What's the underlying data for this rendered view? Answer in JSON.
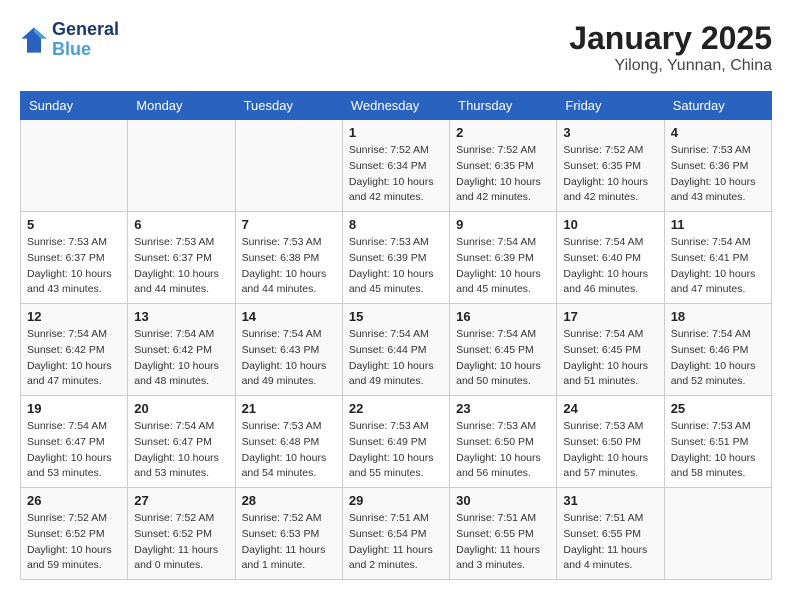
{
  "header": {
    "logo_line1": "General",
    "logo_line2": "Blue",
    "title": "January 2025",
    "subtitle": "Yilong, Yunnan, China"
  },
  "days_of_week": [
    "Sunday",
    "Monday",
    "Tuesday",
    "Wednesday",
    "Thursday",
    "Friday",
    "Saturday"
  ],
  "weeks": [
    [
      {
        "day": "",
        "info": ""
      },
      {
        "day": "",
        "info": ""
      },
      {
        "day": "",
        "info": ""
      },
      {
        "day": "1",
        "info": "Sunrise: 7:52 AM\nSunset: 6:34 PM\nDaylight: 10 hours\nand 42 minutes."
      },
      {
        "day": "2",
        "info": "Sunrise: 7:52 AM\nSunset: 6:35 PM\nDaylight: 10 hours\nand 42 minutes."
      },
      {
        "day": "3",
        "info": "Sunrise: 7:52 AM\nSunset: 6:35 PM\nDaylight: 10 hours\nand 42 minutes."
      },
      {
        "day": "4",
        "info": "Sunrise: 7:53 AM\nSunset: 6:36 PM\nDaylight: 10 hours\nand 43 minutes."
      }
    ],
    [
      {
        "day": "5",
        "info": "Sunrise: 7:53 AM\nSunset: 6:37 PM\nDaylight: 10 hours\nand 43 minutes."
      },
      {
        "day": "6",
        "info": "Sunrise: 7:53 AM\nSunset: 6:37 PM\nDaylight: 10 hours\nand 44 minutes."
      },
      {
        "day": "7",
        "info": "Sunrise: 7:53 AM\nSunset: 6:38 PM\nDaylight: 10 hours\nand 44 minutes."
      },
      {
        "day": "8",
        "info": "Sunrise: 7:53 AM\nSunset: 6:39 PM\nDaylight: 10 hours\nand 45 minutes."
      },
      {
        "day": "9",
        "info": "Sunrise: 7:54 AM\nSunset: 6:39 PM\nDaylight: 10 hours\nand 45 minutes."
      },
      {
        "day": "10",
        "info": "Sunrise: 7:54 AM\nSunset: 6:40 PM\nDaylight: 10 hours\nand 46 minutes."
      },
      {
        "day": "11",
        "info": "Sunrise: 7:54 AM\nSunset: 6:41 PM\nDaylight: 10 hours\nand 47 minutes."
      }
    ],
    [
      {
        "day": "12",
        "info": "Sunrise: 7:54 AM\nSunset: 6:42 PM\nDaylight: 10 hours\nand 47 minutes."
      },
      {
        "day": "13",
        "info": "Sunrise: 7:54 AM\nSunset: 6:42 PM\nDaylight: 10 hours\nand 48 minutes."
      },
      {
        "day": "14",
        "info": "Sunrise: 7:54 AM\nSunset: 6:43 PM\nDaylight: 10 hours\nand 49 minutes."
      },
      {
        "day": "15",
        "info": "Sunrise: 7:54 AM\nSunset: 6:44 PM\nDaylight: 10 hours\nand 49 minutes."
      },
      {
        "day": "16",
        "info": "Sunrise: 7:54 AM\nSunset: 6:45 PM\nDaylight: 10 hours\nand 50 minutes."
      },
      {
        "day": "17",
        "info": "Sunrise: 7:54 AM\nSunset: 6:45 PM\nDaylight: 10 hours\nand 51 minutes."
      },
      {
        "day": "18",
        "info": "Sunrise: 7:54 AM\nSunset: 6:46 PM\nDaylight: 10 hours\nand 52 minutes."
      }
    ],
    [
      {
        "day": "19",
        "info": "Sunrise: 7:54 AM\nSunset: 6:47 PM\nDaylight: 10 hours\nand 53 minutes."
      },
      {
        "day": "20",
        "info": "Sunrise: 7:54 AM\nSunset: 6:47 PM\nDaylight: 10 hours\nand 53 minutes."
      },
      {
        "day": "21",
        "info": "Sunrise: 7:53 AM\nSunset: 6:48 PM\nDaylight: 10 hours\nand 54 minutes."
      },
      {
        "day": "22",
        "info": "Sunrise: 7:53 AM\nSunset: 6:49 PM\nDaylight: 10 hours\nand 55 minutes."
      },
      {
        "day": "23",
        "info": "Sunrise: 7:53 AM\nSunset: 6:50 PM\nDaylight: 10 hours\nand 56 minutes."
      },
      {
        "day": "24",
        "info": "Sunrise: 7:53 AM\nSunset: 6:50 PM\nDaylight: 10 hours\nand 57 minutes."
      },
      {
        "day": "25",
        "info": "Sunrise: 7:53 AM\nSunset: 6:51 PM\nDaylight: 10 hours\nand 58 minutes."
      }
    ],
    [
      {
        "day": "26",
        "info": "Sunrise: 7:52 AM\nSunset: 6:52 PM\nDaylight: 10 hours\nand 59 minutes."
      },
      {
        "day": "27",
        "info": "Sunrise: 7:52 AM\nSunset: 6:52 PM\nDaylight: 11 hours\nand 0 minutes."
      },
      {
        "day": "28",
        "info": "Sunrise: 7:52 AM\nSunset: 6:53 PM\nDaylight: 11 hours\nand 1 minute."
      },
      {
        "day": "29",
        "info": "Sunrise: 7:51 AM\nSunset: 6:54 PM\nDaylight: 11 hours\nand 2 minutes."
      },
      {
        "day": "30",
        "info": "Sunrise: 7:51 AM\nSunset: 6:55 PM\nDaylight: 11 hours\nand 3 minutes."
      },
      {
        "day": "31",
        "info": "Sunrise: 7:51 AM\nSunset: 6:55 PM\nDaylight: 11 hours\nand 4 minutes."
      },
      {
        "day": "",
        "info": ""
      }
    ]
  ]
}
